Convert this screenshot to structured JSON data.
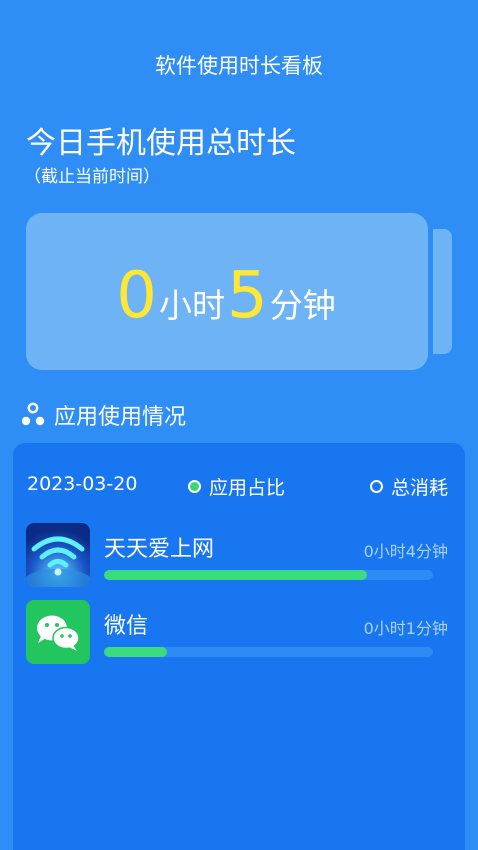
{
  "header": {
    "title": "软件使用时长看板"
  },
  "today": {
    "title": "今日手机使用总时长",
    "subtitle": "（截止当前时间）",
    "hours": "0",
    "hours_unit": "小时",
    "minutes": "5",
    "minutes_unit": "分钟"
  },
  "section": {
    "title": "应用使用情况",
    "icon": "three-dots-share-icon"
  },
  "panel": {
    "date": "2023-03-20",
    "legend_ratio": "应用占比",
    "legend_total": "总消耗",
    "apps": [
      {
        "name": "天天爱上网",
        "time": "0小时4分钟",
        "progress": 0.8,
        "icon": "wifi-app-icon"
      },
      {
        "name": "微信",
        "time": "0小时1分钟",
        "progress": 0.19,
        "icon": "wechat-icon"
      }
    ]
  },
  "colors": {
    "background": "#2f8ef5",
    "panel": "#1877f0",
    "battery": "#6fb3f7",
    "highlight_number": "#ffe834",
    "progress_fill": "#3bdc7d"
  }
}
